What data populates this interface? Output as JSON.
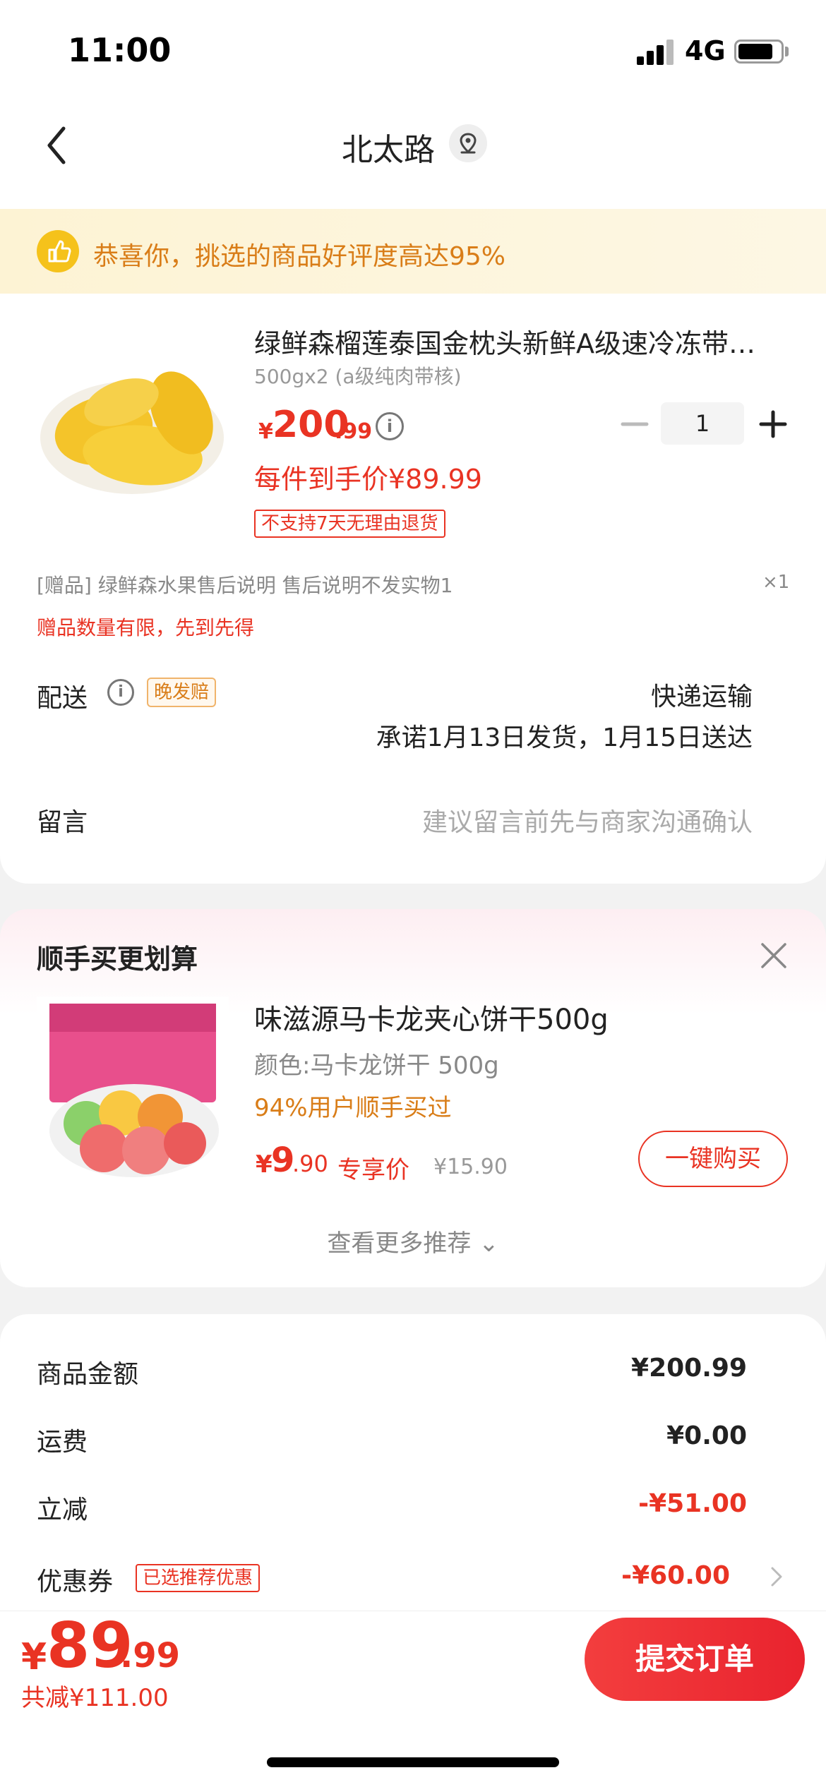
{
  "status_bar": {
    "time": "11:00",
    "network": "4G"
  },
  "nav": {
    "title": "北太路"
  },
  "banner": {
    "text": "恭喜你，挑选的商品好评度高达95%"
  },
  "product": {
    "title": "绿鲜森榴莲泰国金枕头新鲜A级速冷冻带…",
    "spec": "500gx2 (a级纯肉带核)",
    "price_symbol": "¥",
    "price_int": "200",
    "price_dec": ".99",
    "deal_price": "每件到手价¥89.99",
    "no_return": "不支持7天无理由退货",
    "quantity": "1",
    "gift": "[赠品] 绿鲜森水果售后说明 售后说明不发实物1",
    "gift_qty": "×1",
    "gift_limit": "赠品数量有限，先到先得"
  },
  "shipping": {
    "label": "配送",
    "badge": "晚发赔",
    "method": "快递运输",
    "promise": "承诺1月13日发货，1月15日送达"
  },
  "message": {
    "label": "留言",
    "hint": "建议留言前先与商家沟通确认"
  },
  "recommend": {
    "title": "顺手买更划算",
    "item_title": "味滋源马卡龙夹心饼干500g",
    "spec": "颜色:马卡龙饼干 500g",
    "rate": "94%用户顺手买过",
    "price_symbol": "¥",
    "price_int": "9",
    "price_dec": ".90",
    "price_tag": "专享价",
    "old_price": "¥15.90",
    "buy_label": "一键购买",
    "more": "查看更多推荐 ⌄"
  },
  "summary": {
    "rows": [
      {
        "label": "商品金额",
        "value": "¥200.99"
      },
      {
        "label": "运费",
        "value": "¥0.00"
      },
      {
        "label": "立减",
        "value": "-¥51.00"
      },
      {
        "label": "优惠券",
        "value": "-¥60.00"
      }
    ],
    "coupon_badge": "已选推荐优惠"
  },
  "bottom": {
    "total_symbol": "¥",
    "total_int": "89",
    "total_dec": ".99",
    "saved": "共减¥111.00",
    "submit": "提交订单"
  },
  "colors": {
    "accent": "#e93323",
    "orange": "#d97d18",
    "banner_bg": "#fdf3d4"
  }
}
